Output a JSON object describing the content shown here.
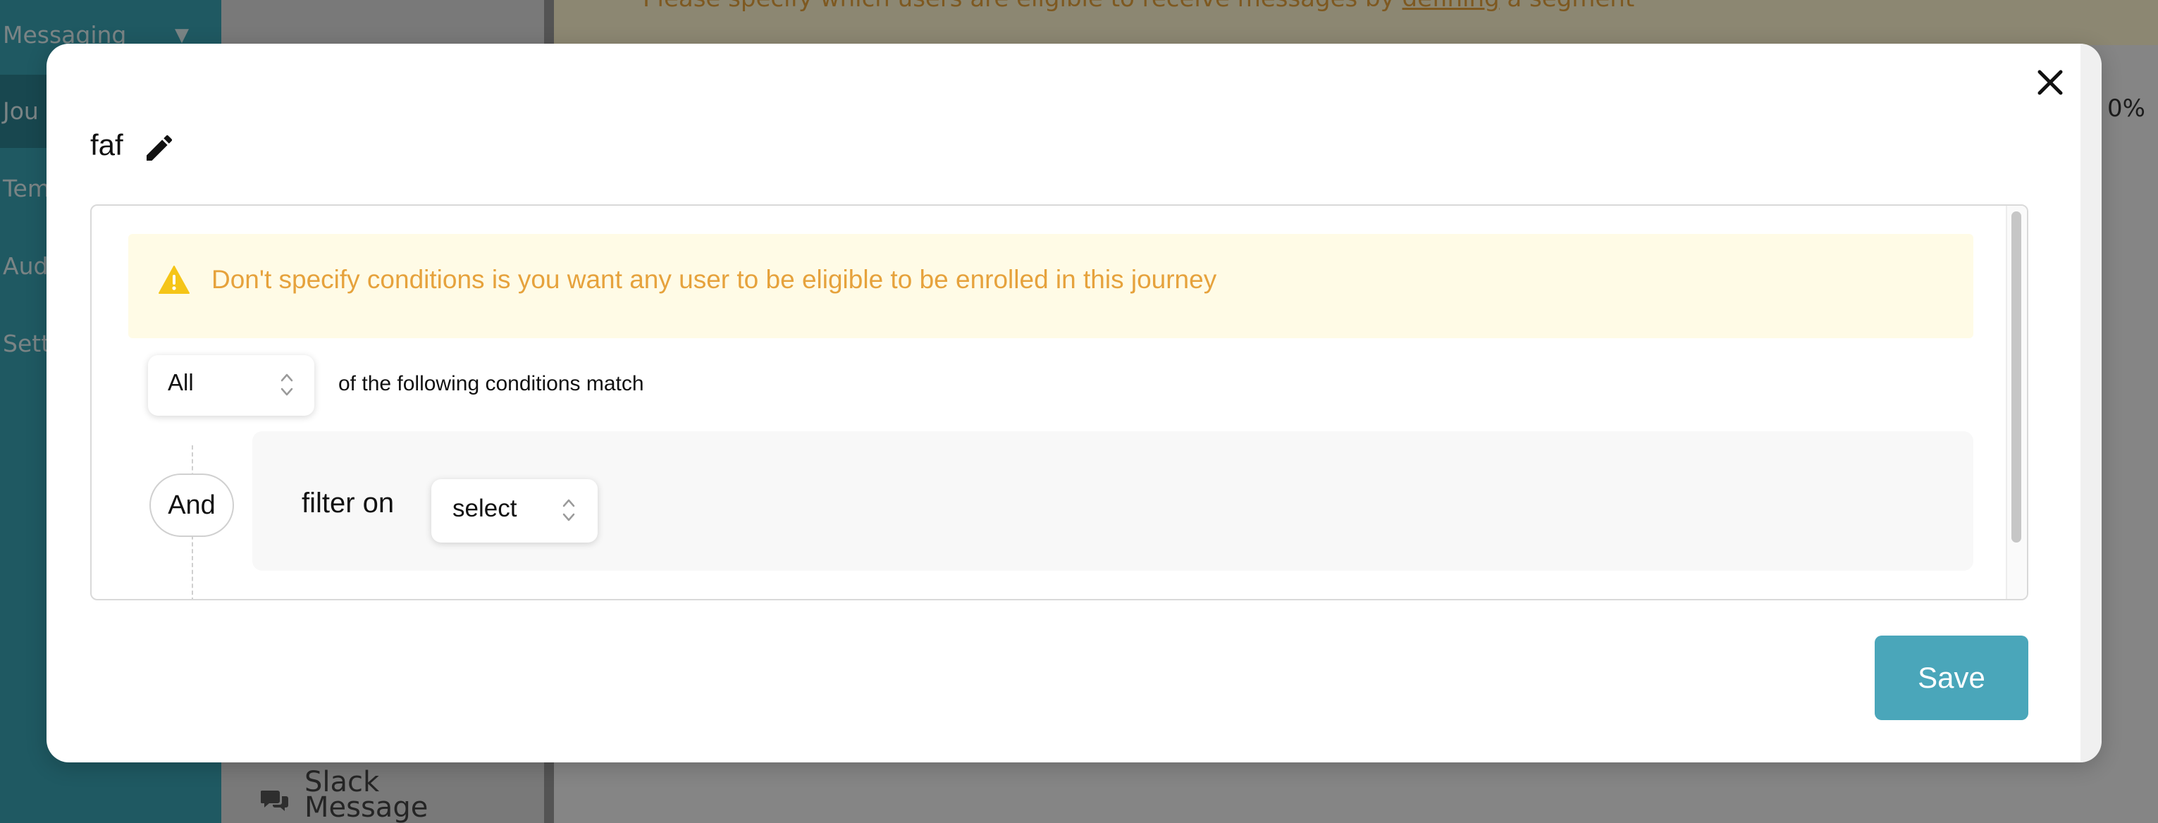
{
  "sidebar": {
    "group_header": "Messaging",
    "items": [
      {
        "label": "Jou"
      },
      {
        "label": "Tem"
      },
      {
        "label": "Aud"
      },
      {
        "label": "Sett"
      }
    ]
  },
  "panel": {
    "slack_label": "Slack Message"
  },
  "background_banner": {
    "text_before": "Please specify which users are eligible to receive messages by ",
    "link_text": "defining",
    "text_after": " a segment"
  },
  "zoom_readout": "0%",
  "modal": {
    "title": "faf",
    "warning": "Don't specify conditions is you want any user to be eligible to be enrolled in this journey",
    "match_selector": {
      "value": "All"
    },
    "match_suffix": "of the following conditions match",
    "operator": "And",
    "filter_label": "filter on",
    "filter_selector": {
      "value": "select"
    },
    "save_label": "Save"
  },
  "colors": {
    "accent": "#4aa6ba",
    "sidebar": "#39a2b3",
    "warning_text": "#e6a23c",
    "warning_bg": "#fffbe6"
  },
  "icons": {
    "close": "close-icon",
    "edit": "pencil-icon",
    "warning": "warning-triangle-icon",
    "select_arrows": "chevron-up-down-icon",
    "chat": "chat-bubbles-icon"
  }
}
